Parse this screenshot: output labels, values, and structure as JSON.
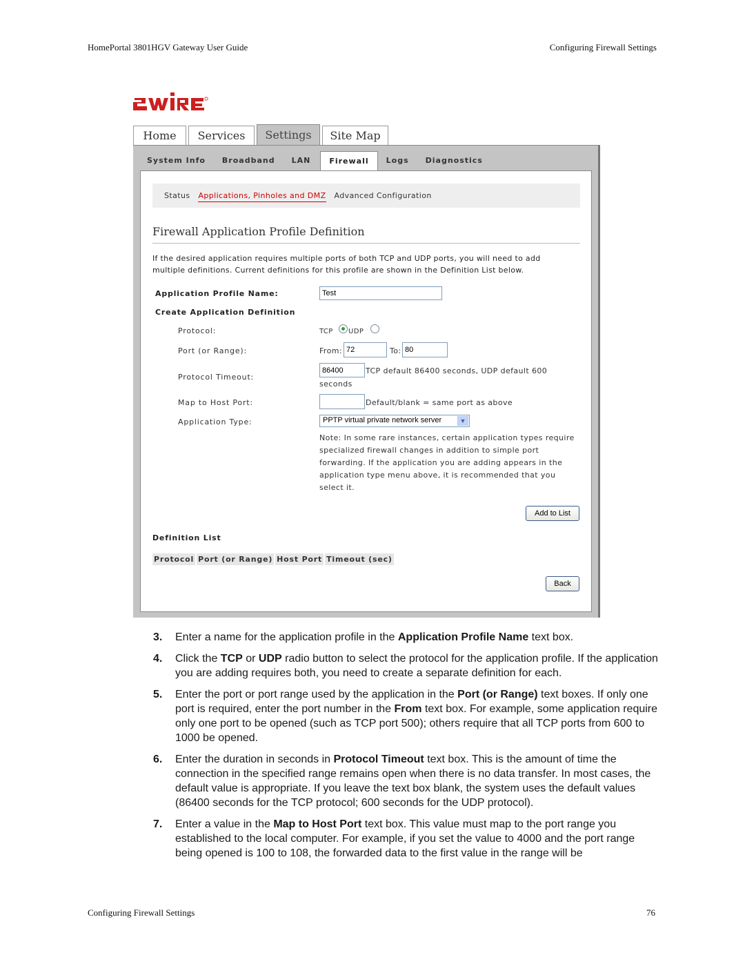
{
  "document": {
    "header_left": "HomePortal 3801HGV Gateway User Guide",
    "header_right": "Configuring Firewall Settings",
    "footer_left": "Configuring Firewall Settings",
    "page_number": "76"
  },
  "brand": {
    "logo_text": "2WIRE",
    "logo_color": "#cc1f1f"
  },
  "top_tabs": [
    {
      "label": "Home",
      "active": false
    },
    {
      "label": "Services",
      "active": false
    },
    {
      "label": "Settings",
      "active": true
    },
    {
      "label": "Site Map",
      "active": false
    }
  ],
  "sub_tabs": [
    {
      "label": "System Info",
      "active": false
    },
    {
      "label": "Broadband",
      "active": false
    },
    {
      "label": "LAN",
      "active": false
    },
    {
      "label": "Firewall",
      "active": true
    },
    {
      "label": "Logs",
      "active": false
    },
    {
      "label": "Diagnostics",
      "active": false
    }
  ],
  "section_nav": {
    "items": [
      "Status",
      "Applications, Pinholes and DMZ",
      "Advanced Configuration"
    ],
    "active_index": 1,
    "active_color": "#cc0000"
  },
  "form": {
    "title": "Firewall Application Profile Definition",
    "intro": "If the desired application requires multiple ports of both TCP and UDP ports, you will need to add multiple definitions. Current definitions for this profile are shown in the Definition List below.",
    "profile_name_label": "Application Profile Name:",
    "profile_name_value": "Test",
    "create_definition_label": "Create Application Definition",
    "protocol_label": "Protocol:",
    "protocol_tcp": "TCP",
    "protocol_udp": "UDP",
    "protocol_selected": "TCP",
    "port_label": "Port (or Range):",
    "port_from_label": "From:",
    "port_from_value": "72",
    "port_to_label": "To:",
    "port_to_value": "80",
    "timeout_label": "Protocol Timeout:",
    "timeout_value": "86400",
    "timeout_hint_1": "TCP default 86400 seconds, UDP default 600",
    "timeout_hint_2": "seconds",
    "host_port_label": "Map to Host Port:",
    "host_port_value": "",
    "host_port_hint": "Default/blank = same port as above",
    "app_type_label": "Application Type:",
    "app_type_value": "PPTP virtual private network server",
    "note": "Note: In some rare instances, certain application types require specialized firewall changes in addition to simple port forwarding. If the application you are adding appears in the application type menu above, it is recommended that you select it.",
    "add_button": "Add to List",
    "definition_list_label": "Definition List",
    "definition_columns": [
      "Protocol",
      "Port (or Range)",
      "Host Port",
      "Timeout (sec)"
    ],
    "back_button": "Back"
  },
  "steps": [
    {
      "num": "3.",
      "parts": [
        [
          "Enter a name for the application profile in the ",
          false
        ],
        [
          "Application Profile Name",
          true
        ],
        [
          " text box.",
          false
        ]
      ]
    },
    {
      "num": "4.",
      "parts": [
        [
          "Click the ",
          false
        ],
        [
          "TCP",
          true
        ],
        [
          " or ",
          false
        ],
        [
          "UDP",
          true
        ],
        [
          " radio button to select the protocol for the application profile. If the application you are adding requires both, you need to create a separate definition for each.",
          false
        ]
      ]
    },
    {
      "num": "5.",
      "parts": [
        [
          "Enter the port or port range used by the application in the ",
          false
        ],
        [
          "Port (or Range)",
          true
        ],
        [
          " text boxes. If only one port is required, enter the port number in the ",
          false
        ],
        [
          "From",
          true
        ],
        [
          " text box. For example, some application require only one port to be opened (such as TCP port 500); others require that all TCP ports from 600 to 1000 be opened.",
          false
        ]
      ]
    },
    {
      "num": "6.",
      "parts": [
        [
          "Enter the duration in seconds in ",
          false
        ],
        [
          "Protocol Timeout",
          true
        ],
        [
          " text box. This is the amount of time the connection in the specified range remains open when there is no data transfer. In most cases, the default value is appropriate. If you leave the text box blank, the system uses the default values (86400 seconds for the TCP protocol; 600 seconds for the UDP protocol).",
          false
        ]
      ]
    },
    {
      "num": "7.",
      "parts": [
        [
          "Enter a value in the ",
          false
        ],
        [
          "Map to Host Port",
          true
        ],
        [
          " text box. This value must map to the port range you established to the local computer. For example, if you set the value to 4000 and the port range being opened is 100 to 108, the forwarded data to the first value in the range will be",
          false
        ]
      ]
    }
  ]
}
